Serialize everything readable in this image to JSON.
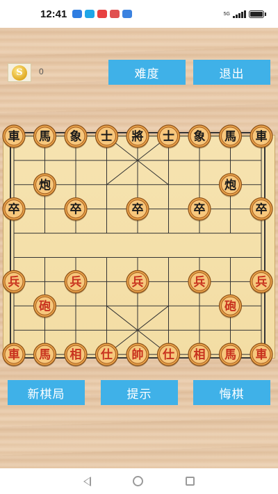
{
  "status_bar": {
    "time": "12:41",
    "network": "5G",
    "notifications": [
      {
        "name": "message-app-icon",
        "color": "#2f7de1"
      },
      {
        "name": "chat-app-icon",
        "color": "#1fa6e8"
      },
      {
        "name": "red-app-icon",
        "color": "#e84040"
      },
      {
        "name": "browser-app-icon",
        "color": "#e05050"
      },
      {
        "name": "blue-app-icon",
        "color": "#3b82e0"
      }
    ]
  },
  "header": {
    "coin_symbol": "S",
    "score": "0",
    "difficulty_label": "难度",
    "exit_label": "退出"
  },
  "footer": {
    "new_game_label": "新棋局",
    "hint_label": "提示",
    "undo_label": "悔棋"
  },
  "board": {
    "files": 9,
    "ranks": 10,
    "board_color": "#f5e1ab",
    "line_color": "#333333",
    "black_text_color": "#1a1a1a",
    "red_text_color": "#c8321e",
    "pieces": [
      {
        "col": 0,
        "row": 0,
        "char": "車",
        "side": "black"
      },
      {
        "col": 1,
        "row": 0,
        "char": "馬",
        "side": "black"
      },
      {
        "col": 2,
        "row": 0,
        "char": "象",
        "side": "black"
      },
      {
        "col": 3,
        "row": 0,
        "char": "士",
        "side": "black"
      },
      {
        "col": 4,
        "row": 0,
        "char": "將",
        "side": "black"
      },
      {
        "col": 5,
        "row": 0,
        "char": "士",
        "side": "black"
      },
      {
        "col": 6,
        "row": 0,
        "char": "象",
        "side": "black"
      },
      {
        "col": 7,
        "row": 0,
        "char": "馬",
        "side": "black"
      },
      {
        "col": 8,
        "row": 0,
        "char": "車",
        "side": "black"
      },
      {
        "col": 1,
        "row": 2,
        "char": "炮",
        "side": "black"
      },
      {
        "col": 7,
        "row": 2,
        "char": "炮",
        "side": "black"
      },
      {
        "col": 0,
        "row": 3,
        "char": "卒",
        "side": "black"
      },
      {
        "col": 2,
        "row": 3,
        "char": "卒",
        "side": "black"
      },
      {
        "col": 4,
        "row": 3,
        "char": "卒",
        "side": "black"
      },
      {
        "col": 6,
        "row": 3,
        "char": "卒",
        "side": "black"
      },
      {
        "col": 8,
        "row": 3,
        "char": "卒",
        "side": "black"
      },
      {
        "col": 0,
        "row": 6,
        "char": "兵",
        "side": "red"
      },
      {
        "col": 2,
        "row": 6,
        "char": "兵",
        "side": "red"
      },
      {
        "col": 4,
        "row": 6,
        "char": "兵",
        "side": "red"
      },
      {
        "col": 6,
        "row": 6,
        "char": "兵",
        "side": "red"
      },
      {
        "col": 8,
        "row": 6,
        "char": "兵",
        "side": "red"
      },
      {
        "col": 1,
        "row": 7,
        "char": "砲",
        "side": "red"
      },
      {
        "col": 7,
        "row": 7,
        "char": "砲",
        "side": "red"
      },
      {
        "col": 0,
        "row": 9,
        "char": "車",
        "side": "red"
      },
      {
        "col": 1,
        "row": 9,
        "char": "馬",
        "side": "red"
      },
      {
        "col": 2,
        "row": 9,
        "char": "相",
        "side": "red"
      },
      {
        "col": 3,
        "row": 9,
        "char": "仕",
        "side": "red"
      },
      {
        "col": 4,
        "row": 9,
        "char": "帥",
        "side": "red"
      },
      {
        "col": 5,
        "row": 9,
        "char": "仕",
        "side": "red"
      },
      {
        "col": 6,
        "row": 9,
        "char": "相",
        "side": "red"
      },
      {
        "col": 7,
        "row": 9,
        "char": "馬",
        "side": "red"
      },
      {
        "col": 8,
        "row": 9,
        "char": "車",
        "side": "red"
      }
    ]
  }
}
